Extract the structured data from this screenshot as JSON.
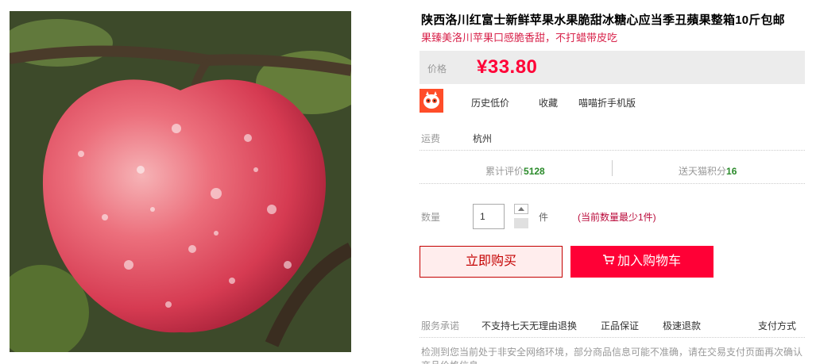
{
  "product": {
    "title": "陕西洛川红富士新鲜苹果水果脆甜冰糖心应当季丑蘋果整箱10斤包邮",
    "subtitle": "果臻美洛川苹果口感脆香甜，不打蜡带皮吃"
  },
  "price": {
    "label": "价格",
    "value": "¥33.80"
  },
  "tools": {
    "icon": "maomao-cat-icon",
    "history": "历史低价",
    "favorite": "收藏",
    "phone": "喵喵折手机版"
  },
  "shipping": {
    "label": "运费",
    "value": "杭州"
  },
  "stats": {
    "reviews_label": "累计评价",
    "reviews_count": "5128",
    "points_label": "送天猫积分",
    "points_count": "16"
  },
  "quantity": {
    "label": "数量",
    "value": "1",
    "unit": "件",
    "note": "(当前数量最少1件)"
  },
  "actions": {
    "buy_now": "立即购买",
    "add_cart": "加入购物车"
  },
  "service": {
    "label": "服务承诺",
    "items": [
      "不支持七天无理由退换",
      "正品保证",
      "极速退款"
    ],
    "payment": "支付方式"
  },
  "warning": "检测到您当前处于非安全网络环境，部分商品信息可能不准确，请在交易支付页面再次确认商品价格信息",
  "colors": {
    "accent": "#ff0036",
    "subtitle": "#d8234b",
    "stat_count": "#2a8a2a"
  }
}
